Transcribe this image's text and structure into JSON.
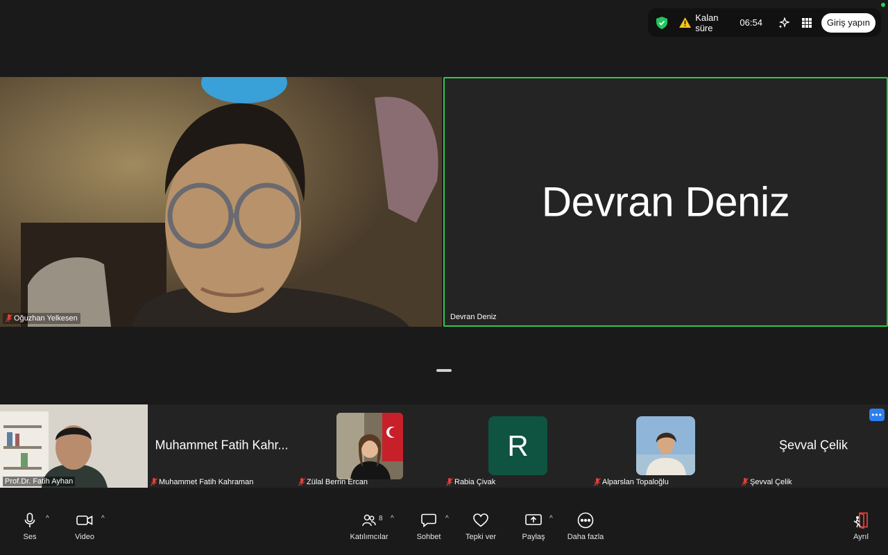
{
  "topbar": {
    "remaining_label": "Kalan süre",
    "remaining_time": "06:54",
    "signin_label": "Giriş yapın"
  },
  "main_tiles": {
    "left_name": "Oğuzhan Yelkesen",
    "right_display_name": "Devran Deniz",
    "right_label": "Devran Deniz"
  },
  "filmstrip": {
    "tiles": [
      {
        "label": "Prof.Dr. Fatih Ayhan"
      },
      {
        "display": "Muhammet Fatih Kahr...",
        "label": "Muhammet Fatih Kahraman"
      },
      {
        "label": "Zülal Berrin Ercan"
      },
      {
        "avatar_letter": "R",
        "label": "Rabia Çivak"
      },
      {
        "label": "Alparslan Topaloğlu"
      },
      {
        "display": "Şevval Çelik",
        "label": "Şevval Çelik"
      }
    ],
    "more_label": "•••"
  },
  "toolbar": {
    "audio_label": "Ses",
    "video_label": "Video",
    "participants_label": "Katılımcılar",
    "participants_count": "8",
    "chat_label": "Sohbet",
    "react_label": "Tepki ver",
    "share_label": "Paylaş",
    "more_label": "Daha fazla",
    "leave_label": "Ayrıl"
  },
  "colors": {
    "active_speaker_border": "#2ec84a",
    "avatar_r_bg": "#0e5440",
    "more_button": "#2d7ff0",
    "mic_off": "#e0413a",
    "leave_icon": "#e0413a"
  }
}
